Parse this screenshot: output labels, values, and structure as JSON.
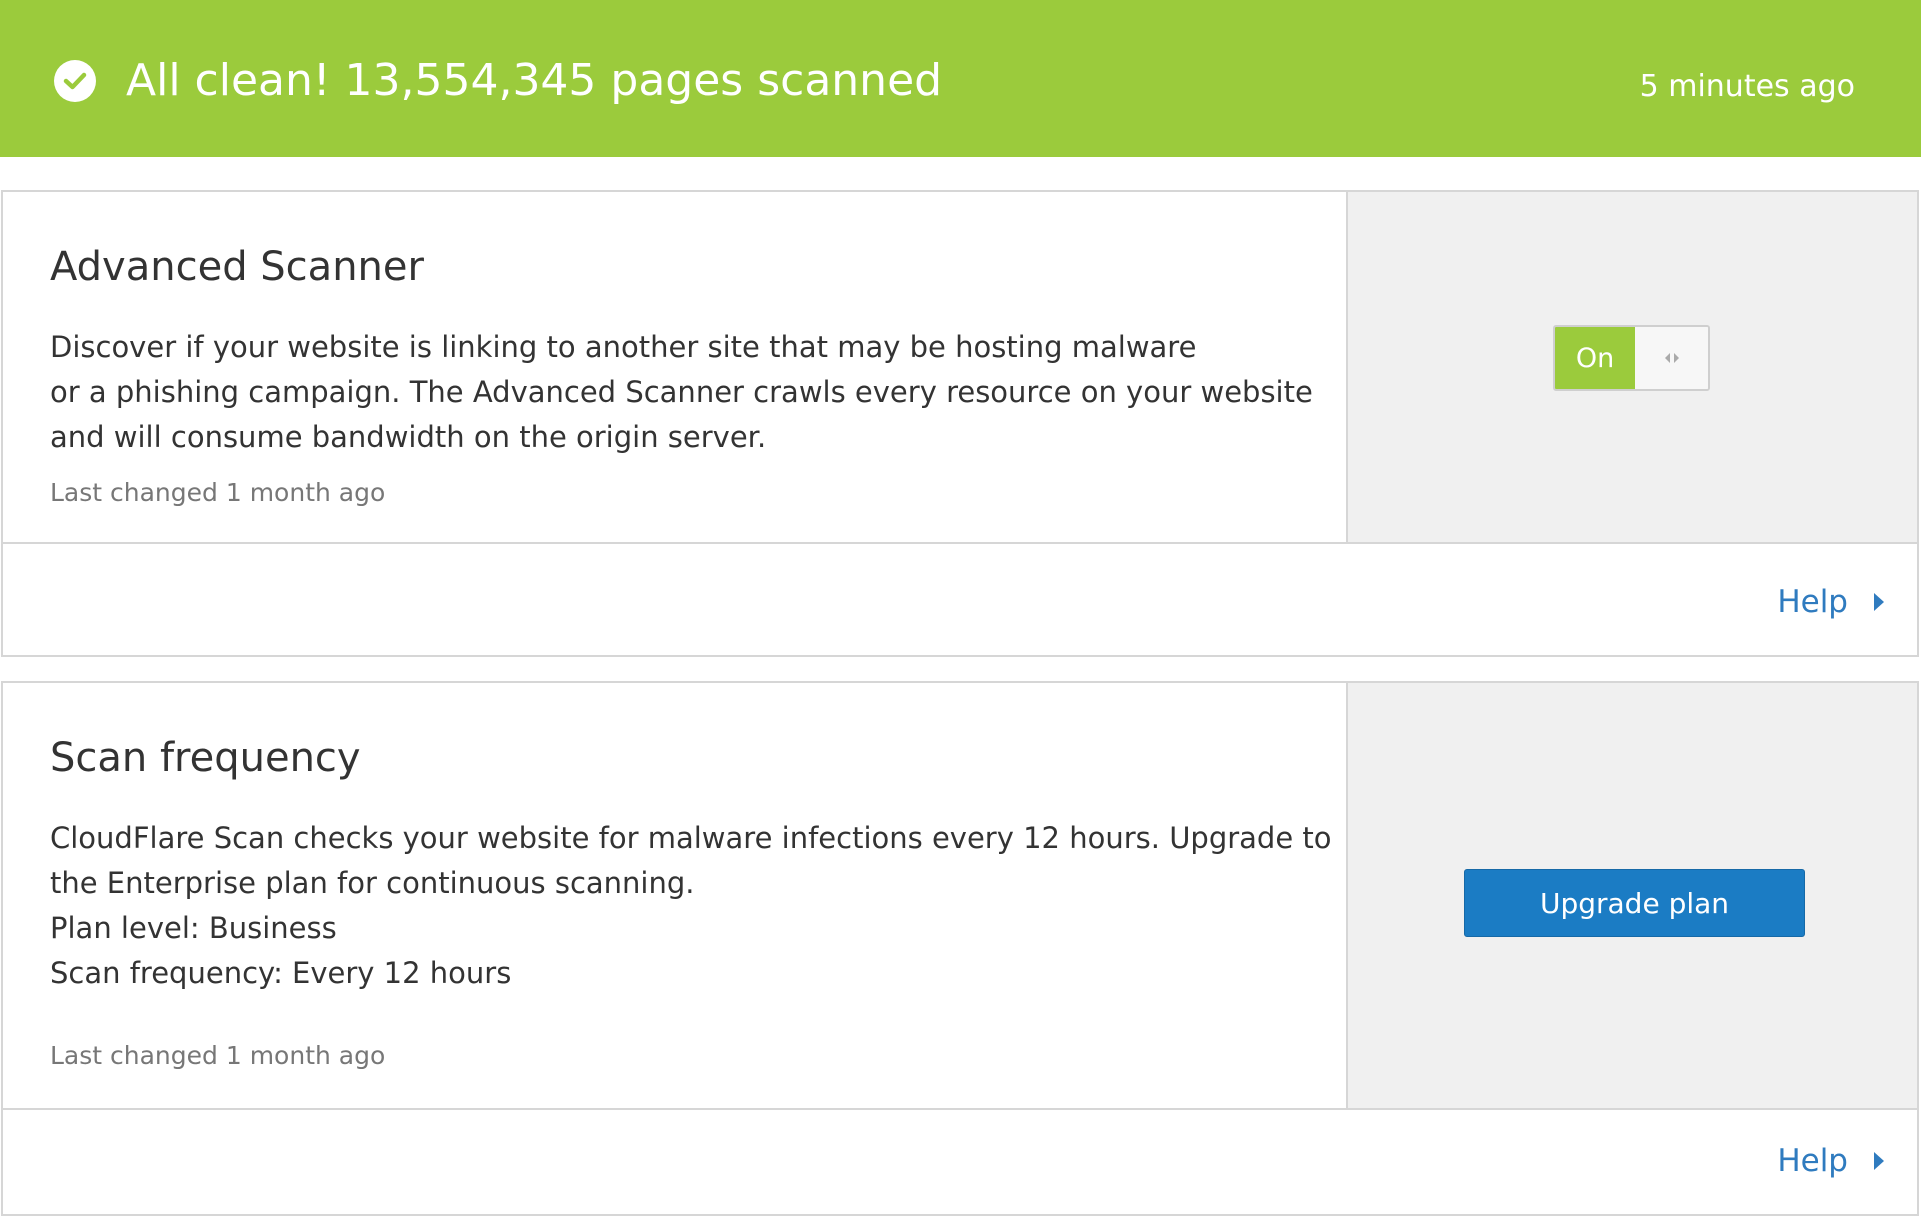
{
  "banner": {
    "title": "All clean! 13,554,345 pages scanned",
    "time": "5 minutes ago",
    "color": "#9bcb3c",
    "icon": "check-circle-icon"
  },
  "advanced_scanner": {
    "title": "Advanced Scanner",
    "description": [
      "Discover if your website is linking to another site that may be hosting malware",
      "or a phishing campaign. The Advanced Scanner crawls every resource on your website",
      "and will consume bandwidth on the origin server."
    ],
    "last_changed": "Last changed 1 month ago",
    "toggle": {
      "label": "On",
      "state": "on"
    },
    "help_label": "Help"
  },
  "scan_frequency": {
    "title": "Scan frequency",
    "description": [
      "CloudFlare Scan checks your website for malware infections every 12 hours. Upgrade to",
      "the Enterprise plan for continuous scanning.",
      "Plan level: Business",
      "Scan frequency: Every 12 hours"
    ],
    "last_changed": "Last changed 1 month ago",
    "button_label": "Upgrade plan",
    "help_label": "Help"
  },
  "colors": {
    "link": "#2f7bbf",
    "button": "#1b7cc4",
    "toggle_on": "#9bcb3c"
  }
}
